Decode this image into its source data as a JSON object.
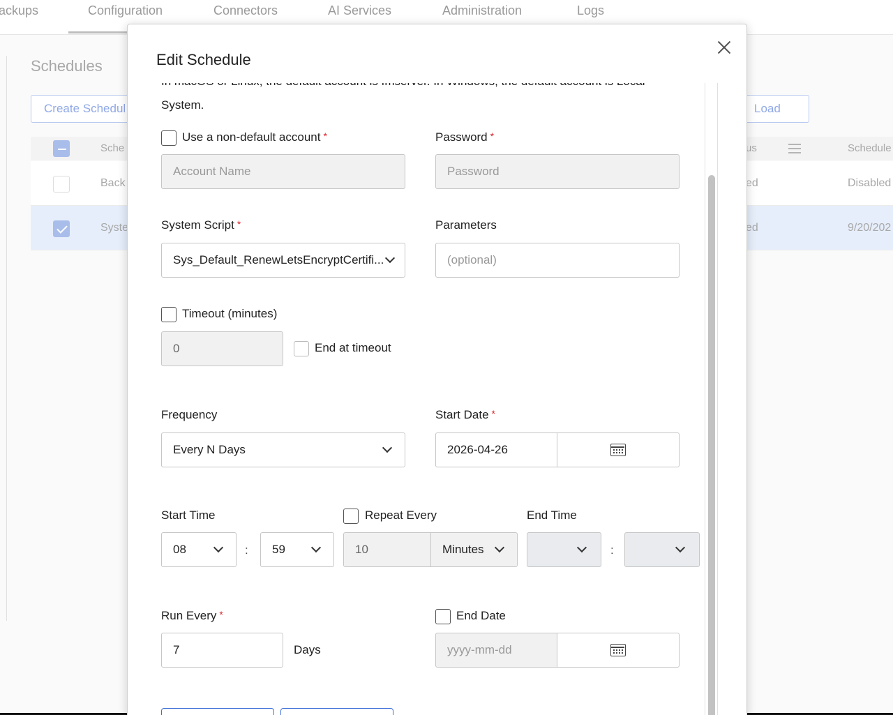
{
  "nav": {
    "tabs": [
      "ackups",
      "Configuration",
      "Connectors",
      "AI Services",
      "Administration",
      "Logs"
    ]
  },
  "background": {
    "title": "Schedules",
    "create_button": "Create Schedul",
    "load_button": "Load",
    "header_col1": "Sche",
    "header_col2": "us",
    "header_col3": "Schedule",
    "rows": [
      {
        "name": "Back",
        "status": "ed",
        "schedule": "Disabled"
      },
      {
        "name": "Syste",
        "status": "ed",
        "schedule": "9/20/202"
      }
    ]
  },
  "modal": {
    "title": "Edit Schedule",
    "info_cut": "In macOS or Linux, the default account is fmserver. In Windows, the default account is Local",
    "info_line": "System.",
    "use_non_default_label": "Use a non-default account",
    "password_label": "Password",
    "account_placeholder": "Account Name",
    "password_placeholder": "Password",
    "system_script_label": "System Script",
    "system_script_value": "Sys_Default_RenewLetsEncryptCertifi...",
    "parameters_label": "Parameters",
    "parameters_placeholder": "(optional)",
    "timeout_label": "Timeout (minutes)",
    "timeout_value": "0",
    "end_at_timeout_label": "End at timeout",
    "frequency_label": "Frequency",
    "frequency_value": "Every N Days",
    "start_date_label": "Start Date",
    "start_date_value": "2026-04-26",
    "start_time_label": "Start Time",
    "start_hour": "08",
    "start_minute": "59",
    "time_sep": ":",
    "repeat_every_label": "Repeat Every",
    "repeat_value": "10",
    "repeat_unit": "Minutes",
    "end_time_label": "End Time",
    "run_every_label": "Run Every",
    "run_every_value": "7",
    "run_every_unit": "Days",
    "end_date_label": "End Date",
    "end_date_placeholder": "yyyy-mm-dd",
    "required_mark": "*"
  }
}
